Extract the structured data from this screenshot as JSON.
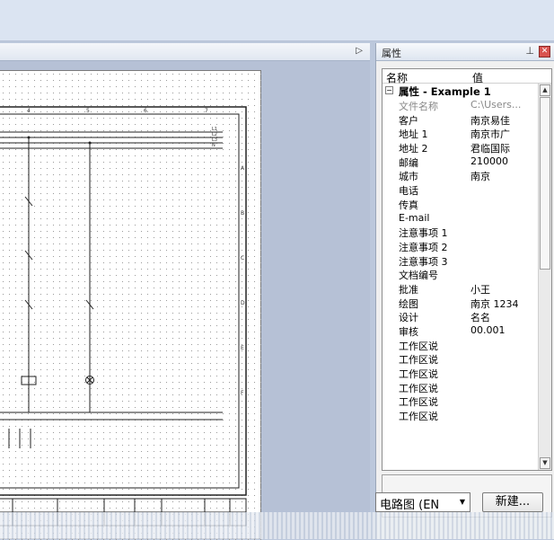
{
  "properties_panel": {
    "title": "属性",
    "pin_icon": "pin-icon",
    "close_icon": "close-icon",
    "header": {
      "name_col": "名称",
      "value_col": "值"
    },
    "group_label": "属性 - Example 1",
    "rows": [
      {
        "key": "文件名称",
        "value": "C:\\Users...",
        "dim": true
      },
      {
        "key": "客户",
        "value": "南京易佳"
      },
      {
        "key": "地址 1",
        "value": "南京市广"
      },
      {
        "key": "地址 2",
        "value": "君临国际"
      },
      {
        "key": "邮编",
        "value": "210000"
      },
      {
        "key": "城市",
        "value": "南京"
      },
      {
        "key": "电话",
        "value": ""
      },
      {
        "key": "传真",
        "value": ""
      },
      {
        "key": "E-mail",
        "value": ""
      },
      {
        "key": "注意事项 1",
        "value": ""
      },
      {
        "key": "注意事项 2",
        "value": ""
      },
      {
        "key": "注意事项 3",
        "value": ""
      },
      {
        "key": "文档编号",
        "value": ""
      },
      {
        "key": "批准",
        "value": "小王"
      },
      {
        "key": "绘图",
        "value": "南京 1234"
      },
      {
        "key": "设计",
        "value": "名名"
      },
      {
        "key": "审核",
        "value": "00.001"
      },
      {
        "key": "工作区说",
        "value": ""
      },
      {
        "key": "工作区说",
        "value": ""
      },
      {
        "key": "工作区说",
        "value": ""
      },
      {
        "key": "工作区说",
        "value": ""
      },
      {
        "key": "工作区说",
        "value": ""
      },
      {
        "key": "工作区说",
        "value": ""
      }
    ]
  },
  "bottom": {
    "diagram_type_selected": "电路图 (EN",
    "new_button_label": "新建..."
  },
  "doc_tabbar": {
    "scroll_arrow": "▷"
  }
}
